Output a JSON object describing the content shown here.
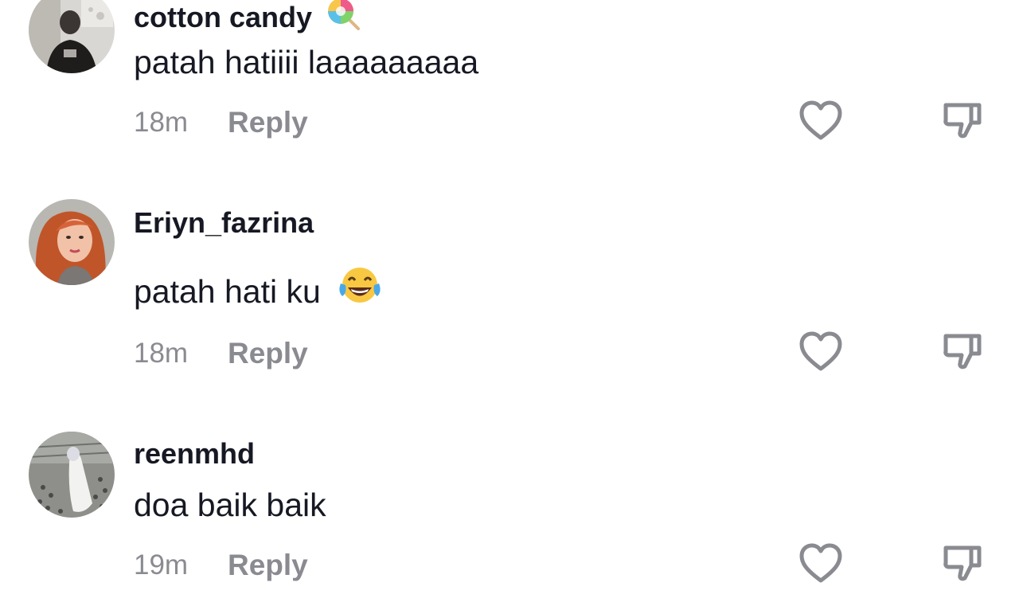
{
  "comments": [
    {
      "username": "cotton candy",
      "username_emoji": "lollipop-emoji",
      "text": "patah hatiiii laaaaaaaaa",
      "time": "18m",
      "reply_label": "Reply"
    },
    {
      "username": "Eriyn_fazrina",
      "text": "patah hati ku",
      "text_emoji": "tears-of-joy-emoji",
      "time": "18m",
      "reply_label": "Reply"
    },
    {
      "username": "reenmhd",
      "text": "doa baik baik",
      "time": "19m",
      "reply_label": "Reply"
    }
  ],
  "colors": {
    "text_primary": "#161823",
    "text_secondary": "#8a8b91",
    "icon": "#8a8b91"
  },
  "icons": {
    "like": "heart-outline-icon",
    "dislike": "thumbs-down-outline-icon"
  }
}
